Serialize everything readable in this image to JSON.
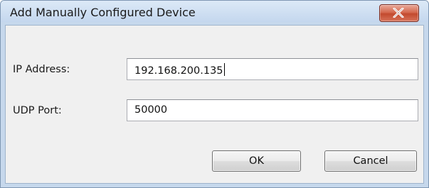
{
  "dialog": {
    "title": "Add Manually Configured Device",
    "close_icon": "close-icon",
    "close_accent": "#c9472c"
  },
  "form": {
    "ip_label": "IP Address:",
    "ip_value": "192.168.200.135",
    "port_label": "UDP Port:",
    "port_value": "50000"
  },
  "buttons": {
    "ok_label": "OK",
    "cancel_label": "Cancel"
  }
}
